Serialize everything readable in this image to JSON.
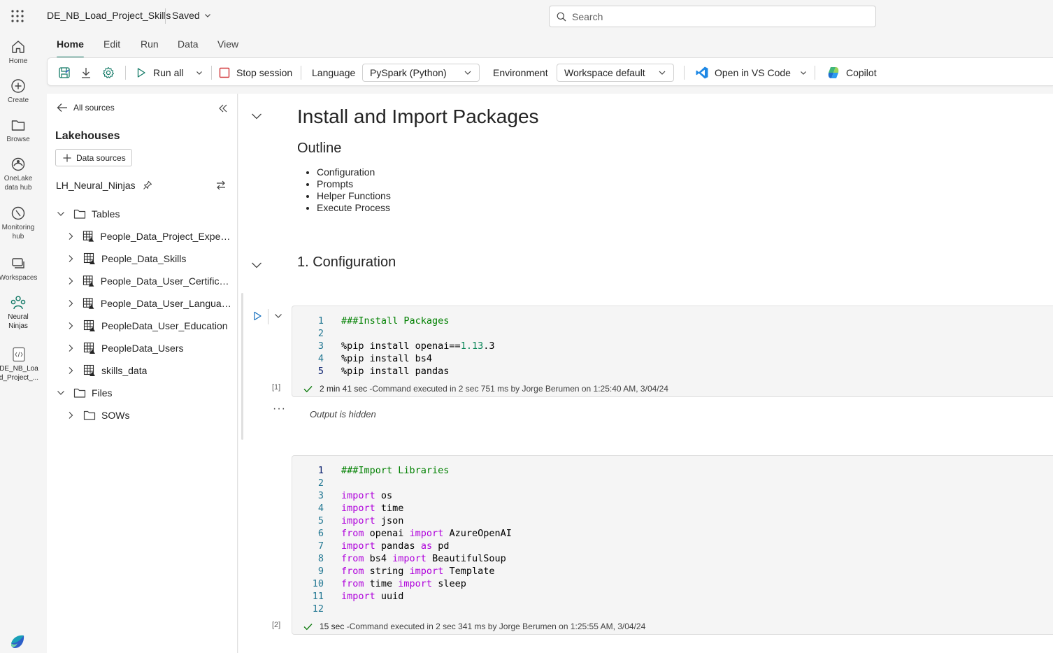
{
  "app": {
    "title": "DE_NB_Load_Project_Skills",
    "saved_label": "Saved",
    "search_placeholder": "Search"
  },
  "rail": {
    "items": [
      {
        "label": "Home",
        "icon": "home-icon"
      },
      {
        "label": "Create",
        "icon": "create-icon"
      },
      {
        "label": "Browse",
        "icon": "browse-icon"
      },
      {
        "label": "OneLake data hub",
        "icon": "onelake-icon"
      },
      {
        "label": "Monitoring hub",
        "icon": "monitoring-icon"
      },
      {
        "label": "Workspaces",
        "icon": "workspaces-icon"
      },
      {
        "label": "Neural Ninjas",
        "icon": "workspace-people-icon"
      },
      {
        "label": "DE_NB_Load_Project_...",
        "icon": "notebook-icon"
      }
    ]
  },
  "menu": {
    "tabs": [
      "Home",
      "Edit",
      "Run",
      "Data",
      "View"
    ],
    "active": "Home"
  },
  "toolbar": {
    "run_all": "Run all",
    "stop_session": "Stop session",
    "language_label": "Language",
    "language_value": "PySpark (Python)",
    "environment_label": "Environment",
    "environment_value": "Workspace default",
    "open_vscode": "Open in VS Code",
    "copilot": "Copilot"
  },
  "explorer": {
    "back_label": "All sources",
    "heading": "Lakehouses",
    "data_sources_button": "Data sources",
    "lakehouse_name": "LH_Neural_Ninjas",
    "tables_folder": "Tables",
    "tables": [
      "People_Data_Project_Experie...",
      "People_Data_Skills",
      "People_Data_User_Certificati...",
      "People_Data_User_Languages",
      "PeopleData_User_Education",
      "PeopleData_Users",
      "skills_data"
    ],
    "files_folder": "Files",
    "files": [
      "SOWs"
    ]
  },
  "notebook": {
    "title": "Install and Import Packages",
    "outline_heading": "Outline",
    "outline_items": [
      "Configuration",
      "Prompts",
      "Helper Functions",
      "Execute Process"
    ],
    "section_heading": "1. Configuration",
    "cell1": {
      "count": "[1]",
      "duration": "2 min 41 sec",
      "status": "-Command executed in 2 sec 751 ms by Jorge Berumen on 1:25:40 AM, 3/04/24",
      "output_hidden": "Output is hidden"
    },
    "cell2": {
      "count": "[2]",
      "duration": "15 sec",
      "status": "-Command executed in 2 sec 341 ms by Jorge Berumen on 1:25:55 AM, 3/04/24"
    }
  },
  "colors": {
    "accent": "#117865",
    "keyword": "#af00db",
    "comment": "#008000",
    "number": "#098658",
    "line_number": "#237893"
  }
}
